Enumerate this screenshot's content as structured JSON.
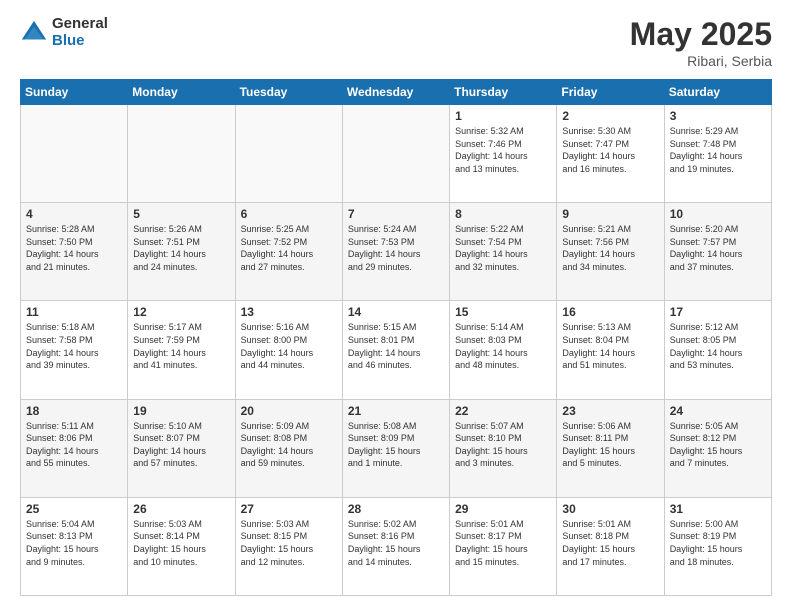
{
  "logo": {
    "general": "General",
    "blue": "Blue"
  },
  "title": {
    "month_year": "May 2025",
    "location": "Ribari, Serbia"
  },
  "days_header": [
    "Sunday",
    "Monday",
    "Tuesday",
    "Wednesday",
    "Thursday",
    "Friday",
    "Saturday"
  ],
  "weeks": [
    [
      {
        "day": "",
        "info": ""
      },
      {
        "day": "",
        "info": ""
      },
      {
        "day": "",
        "info": ""
      },
      {
        "day": "",
        "info": ""
      },
      {
        "day": "1",
        "info": "Sunrise: 5:32 AM\nSunset: 7:46 PM\nDaylight: 14 hours\nand 13 minutes."
      },
      {
        "day": "2",
        "info": "Sunrise: 5:30 AM\nSunset: 7:47 PM\nDaylight: 14 hours\nand 16 minutes."
      },
      {
        "day": "3",
        "info": "Sunrise: 5:29 AM\nSunset: 7:48 PM\nDaylight: 14 hours\nand 19 minutes."
      }
    ],
    [
      {
        "day": "4",
        "info": "Sunrise: 5:28 AM\nSunset: 7:50 PM\nDaylight: 14 hours\nand 21 minutes."
      },
      {
        "day": "5",
        "info": "Sunrise: 5:26 AM\nSunset: 7:51 PM\nDaylight: 14 hours\nand 24 minutes."
      },
      {
        "day": "6",
        "info": "Sunrise: 5:25 AM\nSunset: 7:52 PM\nDaylight: 14 hours\nand 27 minutes."
      },
      {
        "day": "7",
        "info": "Sunrise: 5:24 AM\nSunset: 7:53 PM\nDaylight: 14 hours\nand 29 minutes."
      },
      {
        "day": "8",
        "info": "Sunrise: 5:22 AM\nSunset: 7:54 PM\nDaylight: 14 hours\nand 32 minutes."
      },
      {
        "day": "9",
        "info": "Sunrise: 5:21 AM\nSunset: 7:56 PM\nDaylight: 14 hours\nand 34 minutes."
      },
      {
        "day": "10",
        "info": "Sunrise: 5:20 AM\nSunset: 7:57 PM\nDaylight: 14 hours\nand 37 minutes."
      }
    ],
    [
      {
        "day": "11",
        "info": "Sunrise: 5:18 AM\nSunset: 7:58 PM\nDaylight: 14 hours\nand 39 minutes."
      },
      {
        "day": "12",
        "info": "Sunrise: 5:17 AM\nSunset: 7:59 PM\nDaylight: 14 hours\nand 41 minutes."
      },
      {
        "day": "13",
        "info": "Sunrise: 5:16 AM\nSunset: 8:00 PM\nDaylight: 14 hours\nand 44 minutes."
      },
      {
        "day": "14",
        "info": "Sunrise: 5:15 AM\nSunset: 8:01 PM\nDaylight: 14 hours\nand 46 minutes."
      },
      {
        "day": "15",
        "info": "Sunrise: 5:14 AM\nSunset: 8:03 PM\nDaylight: 14 hours\nand 48 minutes."
      },
      {
        "day": "16",
        "info": "Sunrise: 5:13 AM\nSunset: 8:04 PM\nDaylight: 14 hours\nand 51 minutes."
      },
      {
        "day": "17",
        "info": "Sunrise: 5:12 AM\nSunset: 8:05 PM\nDaylight: 14 hours\nand 53 minutes."
      }
    ],
    [
      {
        "day": "18",
        "info": "Sunrise: 5:11 AM\nSunset: 8:06 PM\nDaylight: 14 hours\nand 55 minutes."
      },
      {
        "day": "19",
        "info": "Sunrise: 5:10 AM\nSunset: 8:07 PM\nDaylight: 14 hours\nand 57 minutes."
      },
      {
        "day": "20",
        "info": "Sunrise: 5:09 AM\nSunset: 8:08 PM\nDaylight: 14 hours\nand 59 minutes."
      },
      {
        "day": "21",
        "info": "Sunrise: 5:08 AM\nSunset: 8:09 PM\nDaylight: 15 hours\nand 1 minute."
      },
      {
        "day": "22",
        "info": "Sunrise: 5:07 AM\nSunset: 8:10 PM\nDaylight: 15 hours\nand 3 minutes."
      },
      {
        "day": "23",
        "info": "Sunrise: 5:06 AM\nSunset: 8:11 PM\nDaylight: 15 hours\nand 5 minutes."
      },
      {
        "day": "24",
        "info": "Sunrise: 5:05 AM\nSunset: 8:12 PM\nDaylight: 15 hours\nand 7 minutes."
      }
    ],
    [
      {
        "day": "25",
        "info": "Sunrise: 5:04 AM\nSunset: 8:13 PM\nDaylight: 15 hours\nand 9 minutes."
      },
      {
        "day": "26",
        "info": "Sunrise: 5:03 AM\nSunset: 8:14 PM\nDaylight: 15 hours\nand 10 minutes."
      },
      {
        "day": "27",
        "info": "Sunrise: 5:03 AM\nSunset: 8:15 PM\nDaylight: 15 hours\nand 12 minutes."
      },
      {
        "day": "28",
        "info": "Sunrise: 5:02 AM\nSunset: 8:16 PM\nDaylight: 15 hours\nand 14 minutes."
      },
      {
        "day": "29",
        "info": "Sunrise: 5:01 AM\nSunset: 8:17 PM\nDaylight: 15 hours\nand 15 minutes."
      },
      {
        "day": "30",
        "info": "Sunrise: 5:01 AM\nSunset: 8:18 PM\nDaylight: 15 hours\nand 17 minutes."
      },
      {
        "day": "31",
        "info": "Sunrise: 5:00 AM\nSunset: 8:19 PM\nDaylight: 15 hours\nand 18 minutes."
      }
    ]
  ]
}
